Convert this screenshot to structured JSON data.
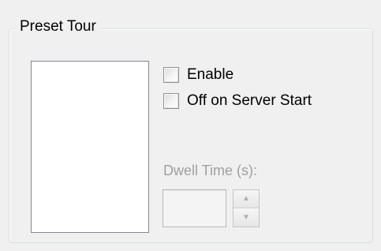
{
  "group": {
    "title": "Preset Tour"
  },
  "checkboxes": [
    {
      "label": "Enable",
      "checked": false
    },
    {
      "label": "Off on Server Start",
      "checked": false
    }
  ],
  "dwell": {
    "label": "Dwell Time (s):",
    "value": "",
    "enabled": false,
    "up_icon": "▲",
    "down_icon": "▼"
  },
  "colors": {
    "disabled_text": "#a0a0a0",
    "groupbox_border": "#d5dfe5"
  }
}
